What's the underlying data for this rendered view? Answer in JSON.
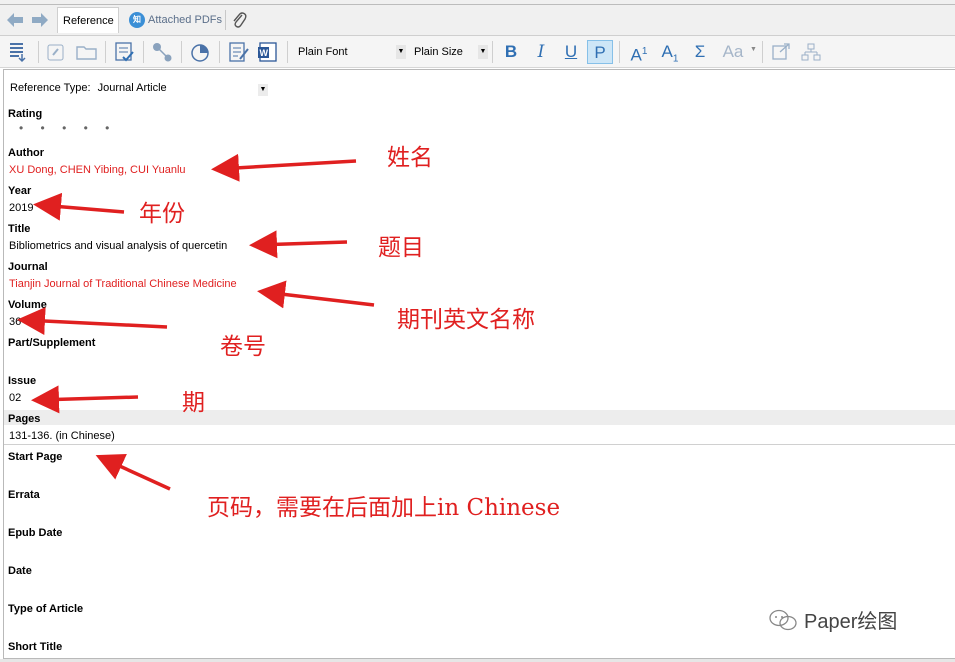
{
  "tabs": {
    "reference": "Reference",
    "attached_pdfs": "Attached PDFs",
    "pdf_badge": "知"
  },
  "toolbar": {
    "font": "Plain Font",
    "size": "Plain Size",
    "bold": "B",
    "italic": "I",
    "underline": "U",
    "plain": "P",
    "superscript_base": "A",
    "superscript_mark": "1",
    "subscript_base": "A",
    "subscript_mark": "1",
    "symbol": "Σ",
    "case": "Aa"
  },
  "reference_type": {
    "label": "Reference Type:",
    "value": "Journal Article"
  },
  "fields": {
    "rating": {
      "label": "Rating",
      "value": "• • • • •"
    },
    "author": {
      "label": "Author",
      "value": "XU Dong, CHEN Yibing, CUI Yuanlu"
    },
    "year": {
      "label": "Year",
      "value": "2019"
    },
    "title": {
      "label": "Title",
      "value": "Bibliometrics and visual analysis of quercetin"
    },
    "journal": {
      "label": "Journal",
      "value": "Tianjin Journal of Traditional Chinese Medicine"
    },
    "volume": {
      "label": "Volume",
      "value": "36"
    },
    "part_supplement": {
      "label": "Part/Supplement",
      "value": ""
    },
    "issue": {
      "label": "Issue",
      "value": "02"
    },
    "pages": {
      "label": "Pages",
      "value": "131-136. (in Chinese)"
    },
    "start_page": {
      "label": "Start Page"
    },
    "errata": {
      "label": "Errata"
    },
    "epub_date": {
      "label": "Epub Date"
    },
    "date": {
      "label": "Date"
    },
    "type_of_article": {
      "label": "Type of Article"
    },
    "short_title": {
      "label": "Short Title"
    }
  },
  "annotations": {
    "author": "姓名",
    "year": "年份",
    "title": "题目",
    "journal": "期刊英文名称",
    "volume": "卷号",
    "issue": "期",
    "pages": "页码，需要在后面加上in Chinese"
  },
  "watermark": "Paper绘图",
  "colors": {
    "accent_red": "#e02020",
    "toolbar_blue": "#2f6fb3",
    "active_format_bg": "#cde6f7"
  }
}
